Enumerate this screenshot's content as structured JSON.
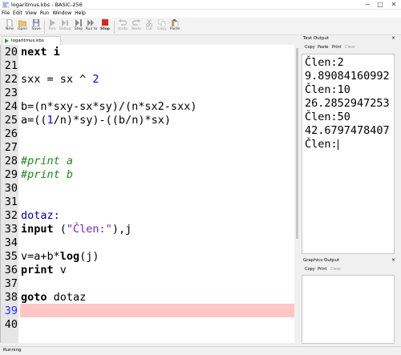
{
  "window": {
    "title": "logaritmus.kbs - BASIC-256",
    "minimize": "─",
    "maximize": "□",
    "close": "✕"
  },
  "menu": [
    "File",
    "Edit",
    "View",
    "Run",
    "Window",
    "Help"
  ],
  "toolbar": [
    {
      "label": "New",
      "icon": "new-file-icon",
      "enabled": true
    },
    {
      "label": "Open",
      "icon": "open-folder-icon",
      "enabled": true
    },
    {
      "label": "Save",
      "icon": "save-icon",
      "enabled": true
    },
    {
      "label": "Run",
      "icon": "run-icon",
      "enabled": false
    },
    {
      "label": "Debug",
      "icon": "debug-icon",
      "enabled": false
    },
    {
      "label": "Step",
      "icon": "step-icon",
      "enabled": true
    },
    {
      "label": "Run to",
      "icon": "run-to-icon",
      "enabled": true
    },
    {
      "label": "Stop",
      "icon": "stop-icon",
      "enabled": true
    },
    {
      "label": "Undo",
      "icon": "undo-icon",
      "enabled": false
    },
    {
      "label": "Redo",
      "icon": "redo-icon",
      "enabled": false
    },
    {
      "label": "Cut",
      "icon": "cut-icon",
      "enabled": false
    },
    {
      "label": "Copy",
      "icon": "copy-icon",
      "enabled": false
    },
    {
      "label": "Paste",
      "icon": "paste-icon",
      "enabled": true
    }
  ],
  "tab": {
    "name": "logaritmus.kbs"
  },
  "editor": {
    "current_line": "39",
    "lines": [
      {
        "n": "20",
        "t": "next i"
      },
      {
        "n": "21",
        "t": ""
      },
      {
        "n": "22",
        "t": "sxx = sx ^ 2"
      },
      {
        "n": "23",
        "t": ""
      },
      {
        "n": "24",
        "t": "b=(n*sxy-sx*sy)/(n*sx2-sxx)"
      },
      {
        "n": "25",
        "t": "a=((1/n)*sy)-((b/n)*sx)"
      },
      {
        "n": "26",
        "t": ""
      },
      {
        "n": "27",
        "t": ""
      },
      {
        "n": "28",
        "t": "#print a"
      },
      {
        "n": "29",
        "t": "#print b"
      },
      {
        "n": "30",
        "t": ""
      },
      {
        "n": "31",
        "t": ""
      },
      {
        "n": "32",
        "t": "dotaz:"
      },
      {
        "n": "33",
        "t": "input (\"Člen:\"),j"
      },
      {
        "n": "34",
        "t": ""
      },
      {
        "n": "35",
        "t": "v=a+b*log(j)"
      },
      {
        "n": "36",
        "t": "print v"
      },
      {
        "n": "37",
        "t": ""
      },
      {
        "n": "38",
        "t": "goto dotaz"
      },
      {
        "n": "39",
        "t": ""
      },
      {
        "n": "40",
        "t": ""
      }
    ]
  },
  "text_output": {
    "title": "Text Output",
    "actions": [
      {
        "label": "Copy",
        "enabled": true
      },
      {
        "label": "Paste",
        "enabled": true
      },
      {
        "label": "Print",
        "enabled": true
      },
      {
        "label": "Clear",
        "enabled": false
      }
    ],
    "lines": [
      "Člen:2",
      "9.89084160992",
      "Člen:10",
      "26.2852947253",
      "Člen:50",
      "42.6797478407",
      "Člen:"
    ]
  },
  "graphics_output": {
    "title": "Graphics Output",
    "actions": [
      {
        "label": "Copy",
        "enabled": true
      },
      {
        "label": "Print",
        "enabled": true
      },
      {
        "label": "Clear",
        "enabled": false
      }
    ]
  },
  "status": "Running"
}
